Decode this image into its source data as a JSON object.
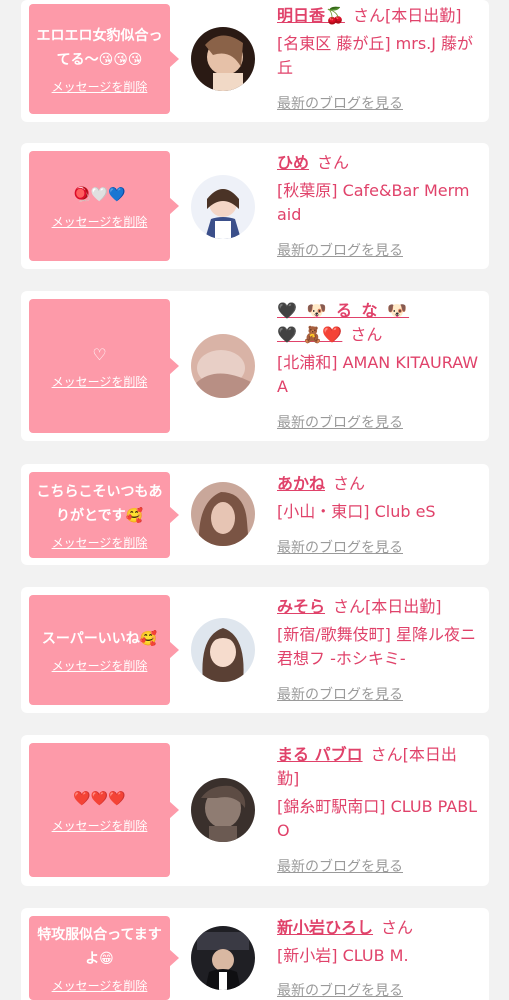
{
  "delete_label": "メッセージを削除",
  "blog_label": "最新のブログを見る",
  "san": "さん",
  "colors": {
    "background": "#f2f2f2",
    "card": "#ffffff",
    "bubble": "#fd9aa9",
    "accent": "#e0426a",
    "link_gray": "#9a9a9a"
  },
  "cards": [
    {
      "message": "エロエロ女豹似合ってる〜😘😘😘",
      "name": "明日香🍒",
      "status": "[本日出勤]",
      "shop": "[名東区 藤が丘] mrs.J 藤が丘"
    },
    {
      "message": "🪀🤍💙",
      "name": "ひめ",
      "status": "",
      "shop": "[秋葉原] Cafe&Bar Mermaid"
    },
    {
      "message": "♡",
      "name_line1": "🖤 🐶 る な 🐶",
      "name_line2": "🖤 🧸❤️",
      "status": "",
      "shop": "[北浦和] AMAN KITAURAWA"
    },
    {
      "message": "こちらこそいつもありがとです🥰",
      "name": "あかね",
      "status": "",
      "shop": "[小山・東口] Club eS"
    },
    {
      "message": "スーパーいいね🥰",
      "name": "みそら",
      "status": "[本日出勤]",
      "shop": "[新宿/歌舞伎町] 星降ル夜ニ君想フ -ホシキミ-"
    },
    {
      "message": "❤️❤️❤️",
      "name": "まる パブロ",
      "status": "[本日出勤]",
      "shop": "[錦糸町駅南口] CLUB PABLO"
    },
    {
      "message": "特攻服似合ってますよ😁",
      "name": "新小岩ひろし",
      "status": "",
      "shop": "[新小岩] CLUB M."
    }
  ]
}
